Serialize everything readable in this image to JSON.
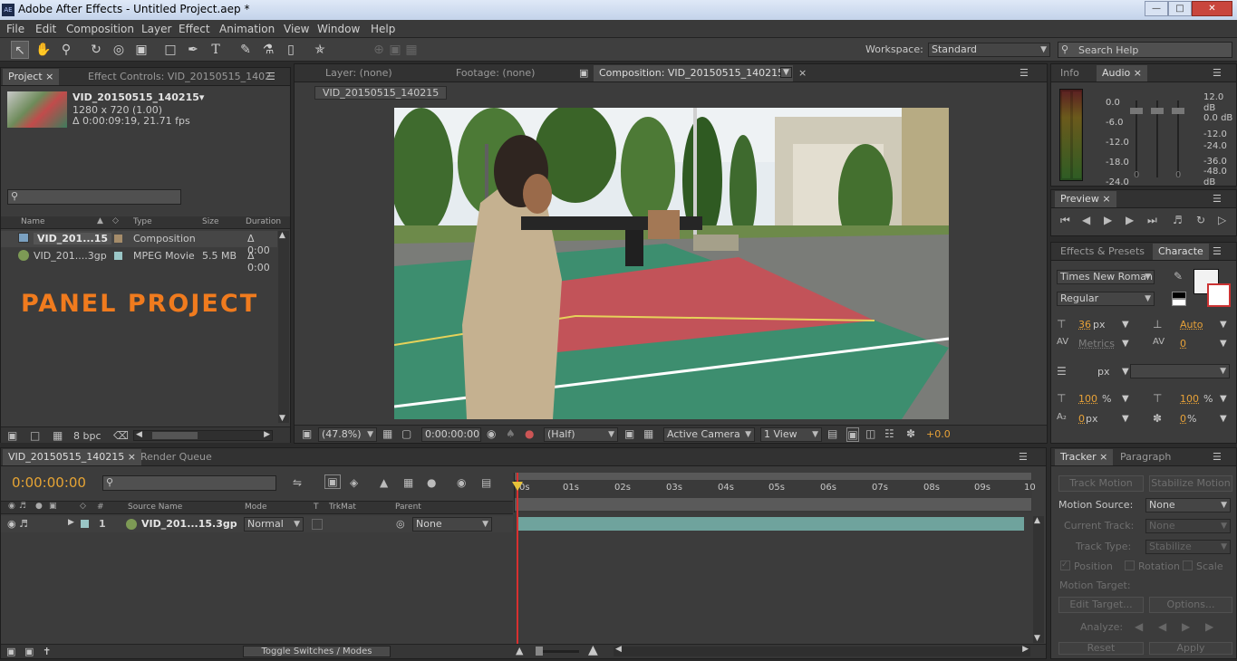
{
  "window": {
    "title": "Adobe After Effects - Untitled Project.aep *",
    "app_icon": "AE"
  },
  "menu": [
    "File",
    "Edit",
    "Composition",
    "Layer",
    "Effect",
    "Animation",
    "View",
    "Window",
    "Help"
  ],
  "toolbar": {
    "workspace_label": "Workspace:",
    "workspace_value": "Standard",
    "search_placeholder": "Search Help"
  },
  "project_panel": {
    "tab_project": "Project",
    "tab_effect_controls": "Effect Controls: VID_20150515_1402",
    "item_name": "VID_20150515_140215▾",
    "item_res": "1280 x 720 (1.00)",
    "item_dur": "Δ 0:00:09:19, 21.71 fps",
    "col_name": "Name",
    "col_type": "Type",
    "col_size": "Size",
    "col_duration": "Duration",
    "rows": [
      {
        "name": "VID_201...15",
        "type": "Composition",
        "size": "",
        "duration": "Δ 0:00"
      },
      {
        "name": "VID_201....3gp",
        "type": "MPEG Movie",
        "size": "5.5 MB",
        "duration": "Δ 0:00"
      }
    ],
    "overlay_label": "PANEL PROJECT",
    "bpc": "8 bpc"
  },
  "viewer": {
    "tab_layer": "Layer: (none)",
    "tab_footage": "Footage: (none)",
    "tab_comp": "Composition: VID_20150515_140215",
    "breadcrumb": "VID_20150515_140215",
    "zoom": "(47.8%)",
    "timecode": "0:00:00:00",
    "resolution": "(Half)",
    "camera": "Active Camera",
    "view": "1 View",
    "exposure": "+0.0"
  },
  "info_audio": {
    "tab_info": "Info",
    "tab_audio": "Audio",
    "left_scale": [
      "0.0",
      "-6.0",
      "-12.0",
      "-18.0",
      "-24.0"
    ],
    "right_scale": [
      "12.0 dB",
      "0.0 dB",
      "-12.0",
      "-24.0",
      "-36.0",
      "-48.0 dB"
    ],
    "slider_zero": "0"
  },
  "preview": {
    "tab": "Preview"
  },
  "character": {
    "tab_effects": "Effects & Presets",
    "tab_character": "Characte",
    "font": "Times New Roman",
    "style": "Regular",
    "size": "36",
    "size_unit": "px",
    "leading": "Auto",
    "kerning": "Metrics",
    "tracking": "0",
    "stroke_unit": "px",
    "vscale": "100",
    "hscale": "100",
    "baseline": "0",
    "baseline_unit": "px",
    "tsume": "0",
    "percent": "%"
  },
  "timeline": {
    "tab_comp": "VID_20150515_140215",
    "tab_render": "Render Queue",
    "timecode": "0:00:00:00",
    "col_source": "Source Name",
    "col_mode": "Mode",
    "col_t": "T",
    "col_trkmat": "TrkMat",
    "col_parent": "Parent",
    "col_num": "#",
    "ticks": [
      "0s",
      "01s",
      "02s",
      "03s",
      "04s",
      "05s",
      "06s",
      "07s",
      "08s",
      "09s",
      "10"
    ],
    "layer": {
      "num": "1",
      "name": "VID_201...15.3gp",
      "mode": "Normal",
      "parent": "None"
    },
    "toggle": "Toggle Switches / Modes"
  },
  "tracker": {
    "tab_tracker": "Tracker",
    "tab_paragraph": "Paragraph",
    "track_motion": "Track Motion",
    "stabilize_motion": "Stabilize Motion",
    "motion_source_label": "Motion Source:",
    "motion_source_value": "None",
    "current_track_label": "Current Track:",
    "current_track_value": "None",
    "track_type_label": "Track Type:",
    "track_type_value": "Stabilize",
    "position": "Position",
    "rotation": "Rotation",
    "scale": "Scale",
    "motion_target": "Motion Target:",
    "edit_target": "Edit Target...",
    "options": "Options...",
    "analyze": "Analyze:",
    "reset": "Reset",
    "apply": "Apply"
  }
}
